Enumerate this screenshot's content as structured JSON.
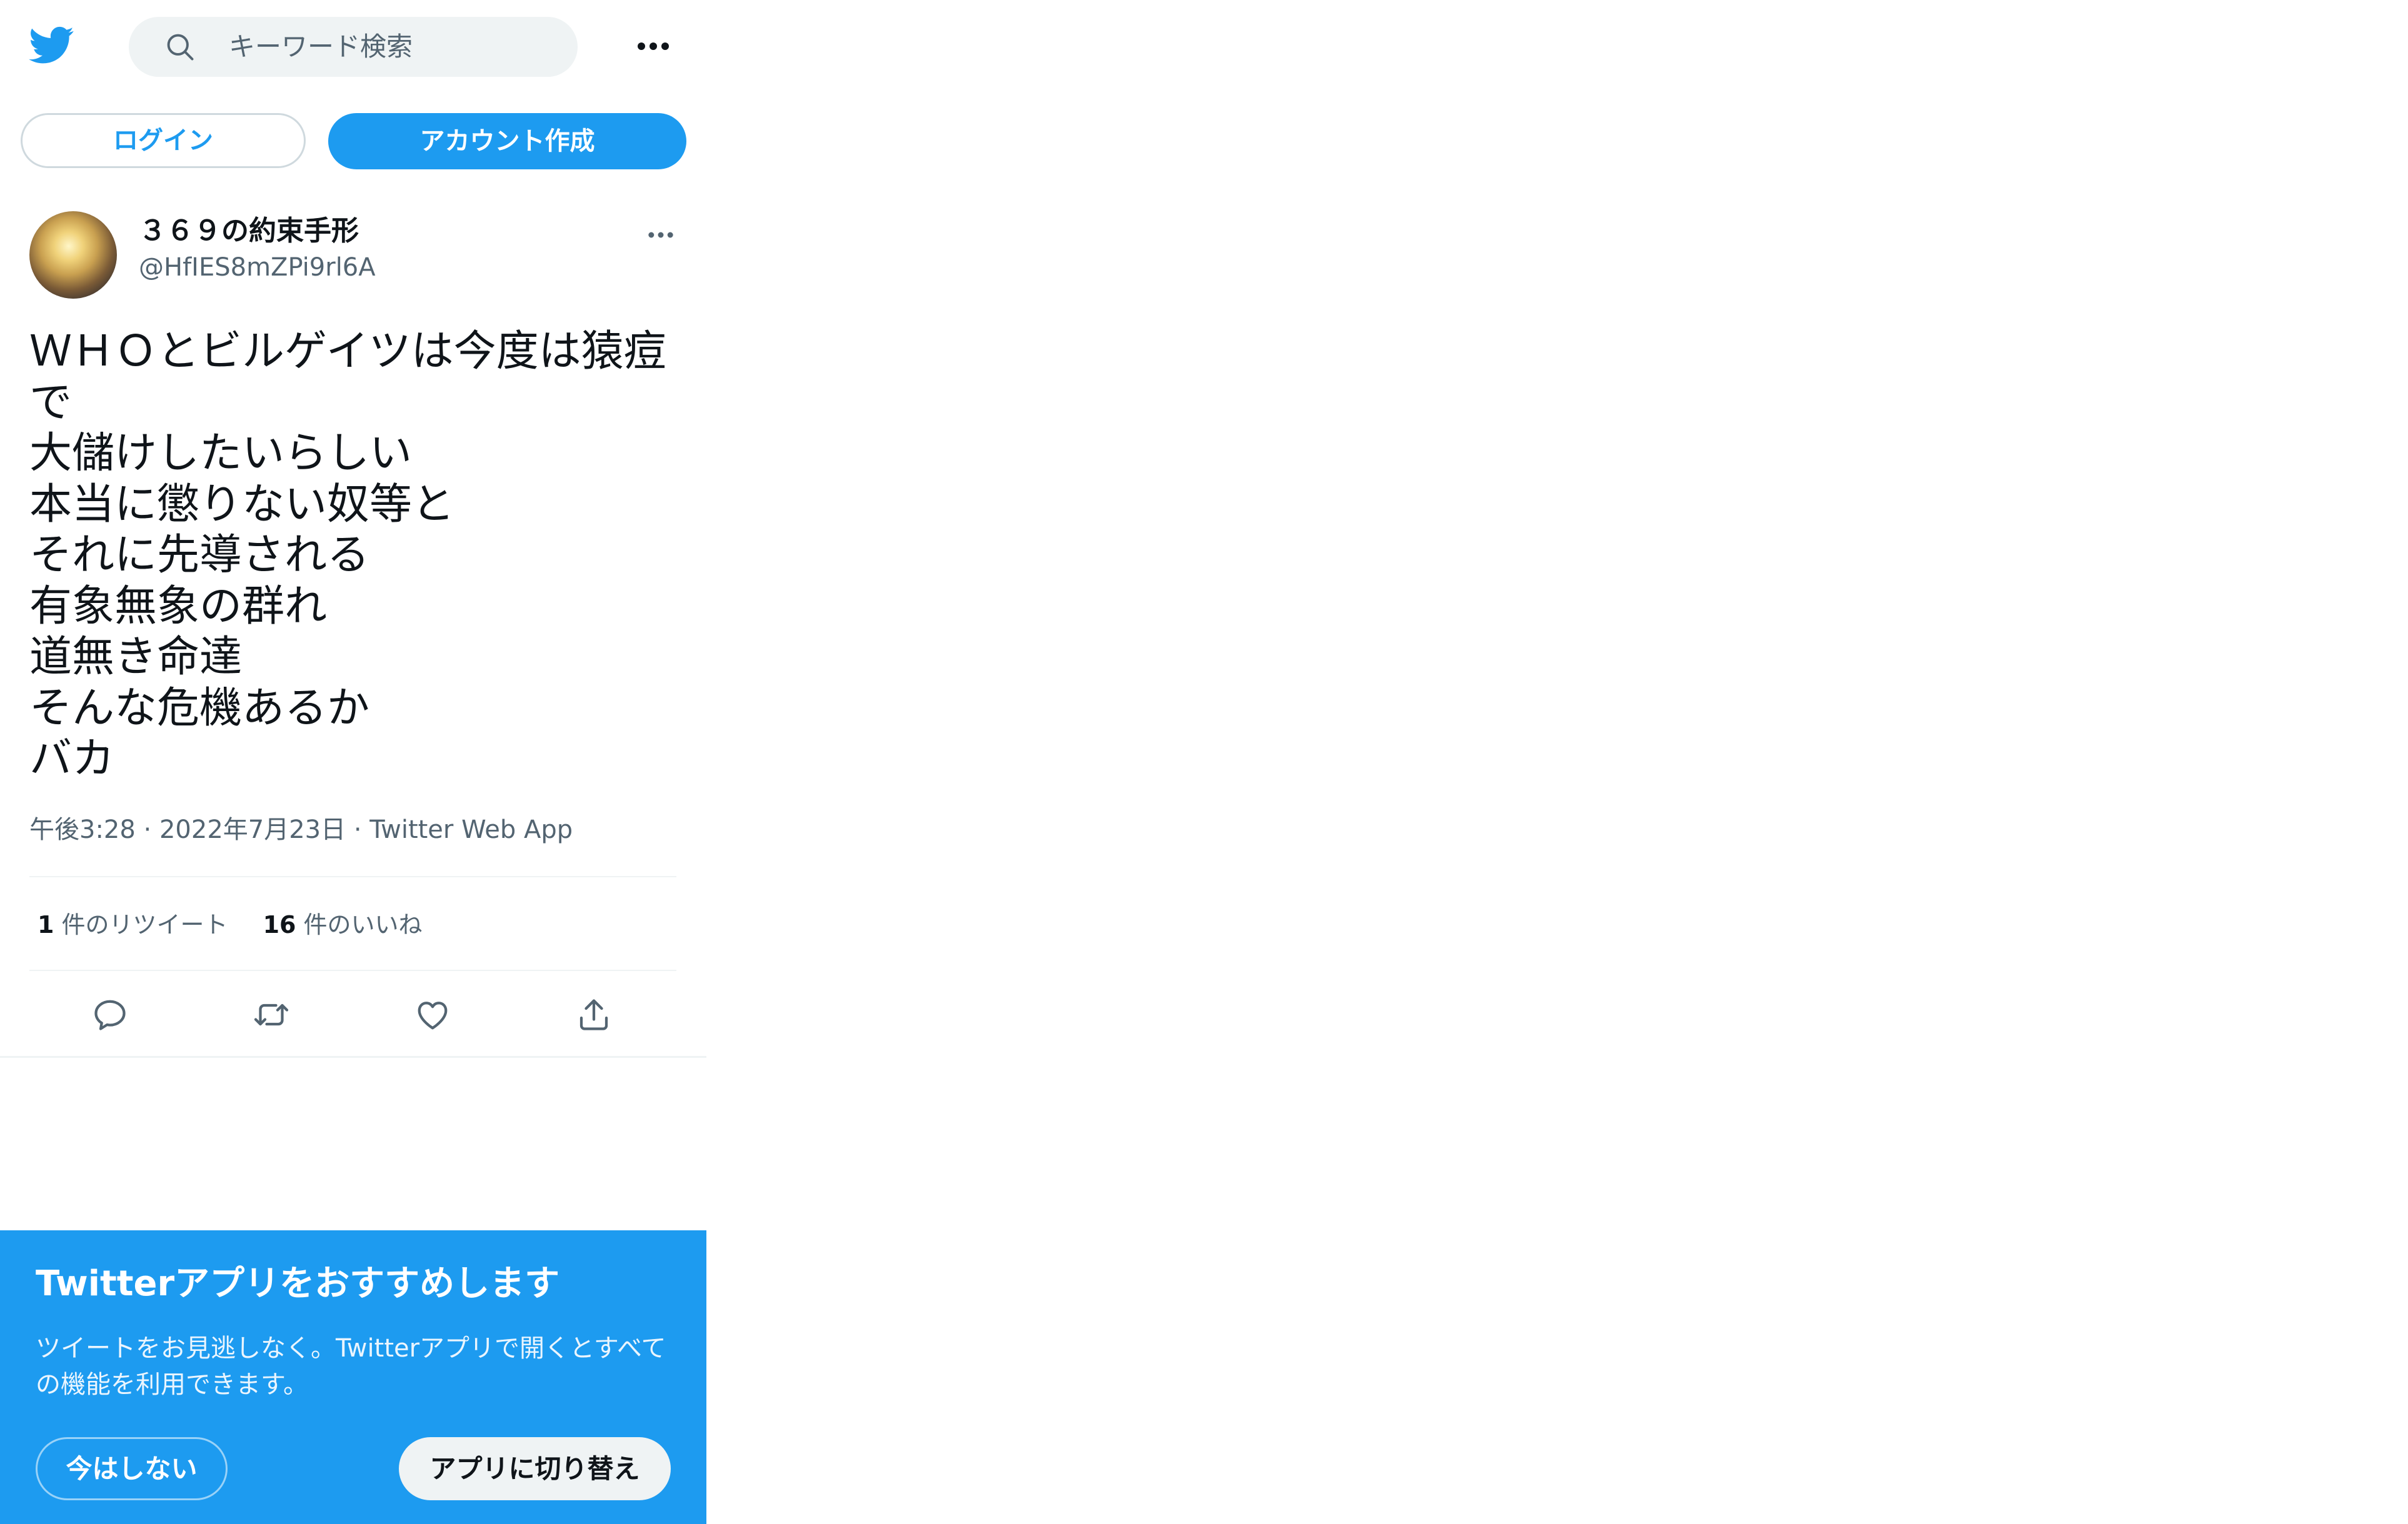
{
  "header": {
    "logo_icon": "twitter-bird-icon",
    "search_placeholder": "キーワード検索",
    "search_icon": "search-icon",
    "more_icon": "more-horizontal-icon"
  },
  "auth": {
    "login_label": "ログイン",
    "signup_label": "アカウント作成"
  },
  "tweet": {
    "author_name": "３６９の約束手形",
    "author_handle": "@HfIES8mZPi9rl6A",
    "text": "ＷＨＯとビルゲイツは今度は猿痘で\n大儲けしたいらしい\n本当に懲りない奴等と\nそれに先導される\n有象無象の群れ\n道無き命達\nそんな危機あるか\nバカ",
    "time": "午後3:28",
    "date": "2022年7月23日",
    "source": "Twitter Web App",
    "retweet_count": "1",
    "retweet_label": "件のリツイート",
    "like_count": "16",
    "like_label": "件のいいね",
    "actions": [
      "reply-icon",
      "retweet-icon",
      "like-icon",
      "share-icon"
    ]
  },
  "app_banner": {
    "title": "Twitterアプリをおすすめします",
    "description": "ツイートをお見逃しなく。Twitterアプリで開くとすべての機能を利用できます。",
    "later_label": "今はしない",
    "switch_label": "アプリに切り替え"
  },
  "colors": {
    "accent": "#1d9bf0",
    "text_primary": "#0f1419",
    "text_secondary": "#536471",
    "search_bg": "#eff3f4"
  }
}
